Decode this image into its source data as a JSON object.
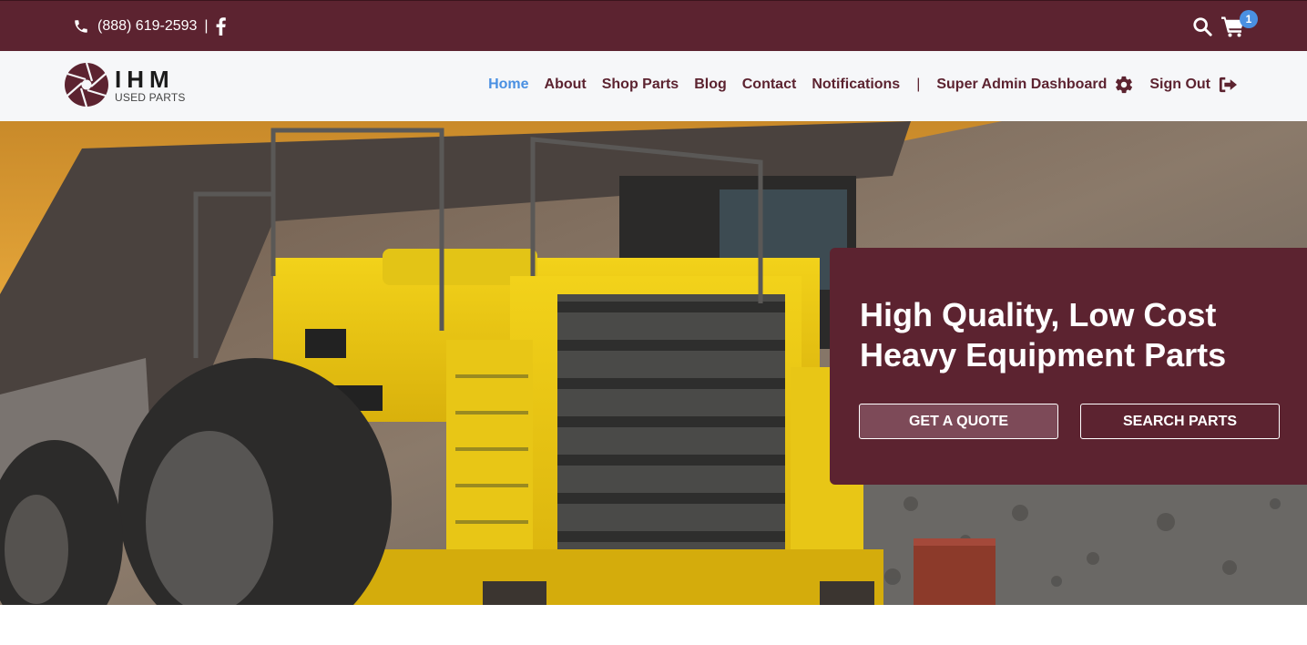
{
  "topbar": {
    "phone": "(888) 619-2593",
    "separator": "|",
    "cart_count": "1",
    "icons": [
      "phone-icon",
      "facebook-icon",
      "search-icon",
      "cart-icon"
    ]
  },
  "logo": {
    "title": "IHM",
    "subtitle": "USED PARTS"
  },
  "nav": {
    "home": "Home",
    "about": "About",
    "shop_parts": "Shop Parts",
    "blog": "Blog",
    "contact": "Contact",
    "notifications": "Notifications",
    "divider": "|",
    "super_admin": "Super Admin Dashboard",
    "sign_out": "Sign Out",
    "icons": [
      "gear-icon",
      "sign-out-icon"
    ]
  },
  "hero": {
    "headline": "High Quality, Low Cost Heavy Equipment Parts",
    "quote_button": "Get a Quote",
    "search_button": "Search Parts"
  },
  "colors": {
    "brand": "#5c2330",
    "active_link": "#4a90e2",
    "quote_button_bg": "#7d4a58",
    "nav_bg": "#f6f7f9"
  }
}
